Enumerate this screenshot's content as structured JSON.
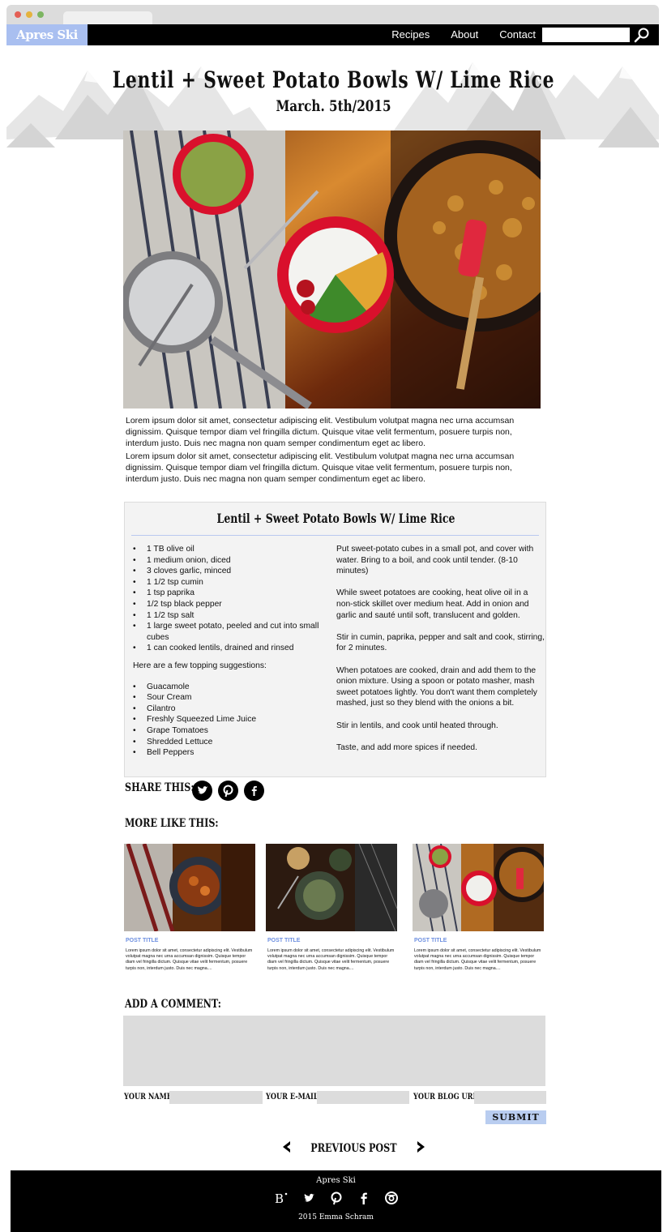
{
  "site": {
    "logo": "Apres Ski"
  },
  "nav": {
    "items": [
      {
        "label": "Recipes"
      },
      {
        "label": "About"
      },
      {
        "label": "Contact"
      }
    ],
    "search_value": ""
  },
  "post": {
    "title": "Lentil + Sweet Potato Bowls W/ Lime Rice",
    "date": "March. 5th/2015",
    "paragraphs": [
      "Lorem ipsum dolor sit amet, consectetur adipiscing elit. Vestibulum volutpat magna nec urna accumsan dignissim. Quisque tempor diam vel fringilla dictum. Quisque vitae velit fermentum, posuere turpis non, interdum justo. Duis nec magna non quam semper condimentum eget ac libero.",
      "Lorem ipsum dolor sit amet, consectetur adipiscing elit. Vestibulum volutpat magna nec urna accumsan dignissim. Quisque tempor diam vel fringilla dictum. Quisque vitae velit fermentum, posuere turpis non, interdum justo. Duis nec magna non quam semper condimentum eget ac libero."
    ]
  },
  "recipe": {
    "title": "Lentil + Sweet Potato Bowls W/ Lime Rice",
    "ingredients": [
      "1 TB olive oil",
      "1 medium onion, diced",
      "3 cloves garlic, minced",
      "1 1/2 tsp cumin",
      "1 tsp paprika",
      "1/2 tsp black pepper",
      "1 1/2 tsp salt",
      "1 large sweet potato, peeled and cut into small cubes",
      "1 can cooked lentils, drained and rinsed"
    ],
    "toppings_intro": "Here are a few topping suggestions:",
    "toppings": [
      "Guacamole",
      "Sour Cream",
      "Cilantro",
      "Freshly Squeezed Lime Juice",
      "Grape Tomatoes",
      "Shredded Lettuce",
      "Bell Peppers"
    ],
    "directions": [
      "Put sweet-potato cubes in a small pot, and cover with water. Bring to a boil, and cook until tender. (8-10 minutes)",
      "While sweet potatoes are cooking, heat olive oil in a non-stick skillet over medium heat. Add in onion and garlic and sauté until soft, translucent and golden.",
      "Stir in cumin, paprika, pepper and salt and cook, stirring, for 2 minutes.",
      "When potatoes are cooked, drain and add them to the onion mixture. Using a spoon or potato masher, mash sweet potatoes lightly. You don't want them completely mashed, just so they blend with the onions a bit.",
      "Stir in lentils, and cook until heated through.",
      "Taste, and add more spices if needed."
    ]
  },
  "share": {
    "label": "SHARE THIS:",
    "icons": [
      "twitter-icon",
      "pinterest-icon",
      "facebook-icon"
    ]
  },
  "more_like_this": {
    "label": "MORE LIKE THIS:",
    "posts": [
      {
        "title": "POST TITLE",
        "excerpt": "Lorem ipsum dolor sit amet, consectetur adipiscing elit. Vestibulum volutpat magna nec urna accumsan dignissim. Quisque tempor diam vel fringilla dictum. Quisque vitae velit fermentum, posuere turpis non, interdum justo. Duis nec magna...."
      },
      {
        "title": "POST TITLE",
        "excerpt": "Lorem ipsum dolor sit amet, consectetur adipiscing elit. Vestibulum volutpat magna nec urna accumsan dignissim. Quisque tempor diam vel fringilla dictum. Quisque vitae velit fermentum, posuere turpis non, interdum justo. Duis nec magna...."
      },
      {
        "title": "POST TITLE",
        "excerpt": "Lorem ipsum dolor sit amet, consectetur adipiscing elit. Vestibulum volutpat magna nec urna accumsan dignissim. Quisque tempor diam vel fringilla dictum. Quisque vitae velit fermentum, posuere turpis non, interdum justo. Duis nec magna...."
      }
    ]
  },
  "comment": {
    "label": "ADD A COMMENT:",
    "value": "",
    "name_label": "YOUR NAME:",
    "email_label": "YOUR E-MAIL:",
    "url_label": "YOUR BLOG URL:",
    "submit_label": "SUBMIT"
  },
  "pagination": {
    "previous_label": "PREVIOUS POST"
  },
  "footer": {
    "name": "Apres Ski",
    "icons": [
      "blogger-icon",
      "twitter-icon",
      "pinterest-icon",
      "facebook-icon",
      "instagram-icon"
    ],
    "copyright": "2015 Emma Schram"
  },
  "colors": {
    "accent": "#a9bff0",
    "submit": "#b9cdf0",
    "link": "#6d8fe0",
    "panel": "#f3f3f3",
    "input": "#dcdcdc"
  }
}
